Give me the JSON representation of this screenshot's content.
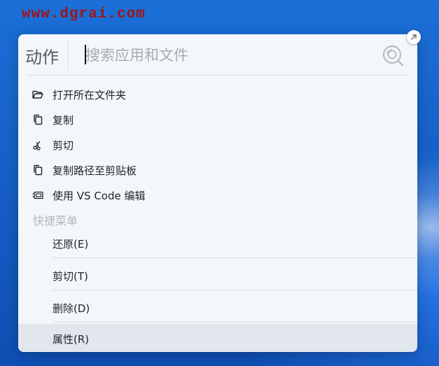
{
  "watermark": "www.dgrai.com",
  "launcher": {
    "mode_label": "动作",
    "search_placeholder": "搜索应用和文件",
    "search_value": ""
  },
  "actions": [
    {
      "label": "打开所在文件夹",
      "icon": "folder-open-icon"
    },
    {
      "label": "复制",
      "icon": "copy-icon"
    },
    {
      "label": "剪切",
      "icon": "scissors-icon"
    },
    {
      "label": "复制路径至剪贴板",
      "icon": "copy-path-icon"
    },
    {
      "label": "使用 VS Code 编辑",
      "icon": "vscode-icon"
    }
  ],
  "quick_menu": {
    "title": "快捷菜单",
    "items": [
      {
        "label": "还原(E)",
        "selected": false
      },
      {
        "label": "剪切(T)",
        "selected": false
      },
      {
        "label": "删除(D)",
        "selected": false
      },
      {
        "label": "属性(R)",
        "selected": true
      }
    ]
  },
  "colors": {
    "panel_bg": "#f3f6fb",
    "selected_bg": "#e2e7ee",
    "watermark": "#a0141a",
    "desktop_blue": "#1762c9"
  }
}
